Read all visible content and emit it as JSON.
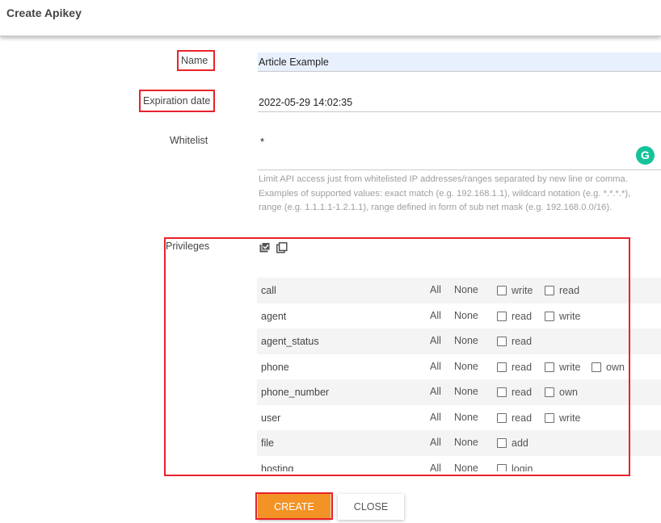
{
  "dialog": {
    "title": "Create Apikey"
  },
  "form": {
    "name": {
      "label": "Name",
      "value": "Article Example"
    },
    "expiration": {
      "label": "Expiration date",
      "value": "2022-05-29 14:02:35"
    },
    "whitelist": {
      "label": "Whitelist",
      "value": "*",
      "hint_lines": [
        "Limit API access just from whitelisted IP addresses/ranges separated by new line or comma.",
        "Examples of supported values: exact match (e.g. 192.168.1.1), wildcard notation (e.g. *.*.*.*),",
        "range (e.g. 1.1.1.1-1.2.1.1), range defined in form of sub net mask (e.g. 192.168.0.0/16)."
      ]
    },
    "privileges": {
      "label": "Privileges",
      "all_label": "All",
      "none_label": "None",
      "rows": [
        {
          "name": "call",
          "perms": [
            "write",
            "read"
          ]
        },
        {
          "name": "agent",
          "perms": [
            "read",
            "write"
          ]
        },
        {
          "name": "agent_status",
          "perms": [
            "read"
          ]
        },
        {
          "name": "phone",
          "perms": [
            "read",
            "write",
            "own"
          ]
        },
        {
          "name": "phone_number",
          "perms": [
            "read",
            "own"
          ]
        },
        {
          "name": "user",
          "perms": [
            "read",
            "write"
          ]
        },
        {
          "name": "file",
          "perms": [
            "add"
          ]
        },
        {
          "name": "hosting",
          "perms": [
            "login"
          ]
        }
      ]
    }
  },
  "buttons": {
    "create": "CREATE",
    "close": "CLOSE"
  },
  "icons": {
    "grammarly": "grammarly-icon",
    "select_all": "checkbox-checked-stack-icon",
    "select_none": "checkbox-empty-stack-icon"
  },
  "colors": {
    "accent": "#f39325",
    "highlight_border": "#e8222a",
    "autofill_bg": "#e8f0fe",
    "grammarly": "#15c39a"
  }
}
